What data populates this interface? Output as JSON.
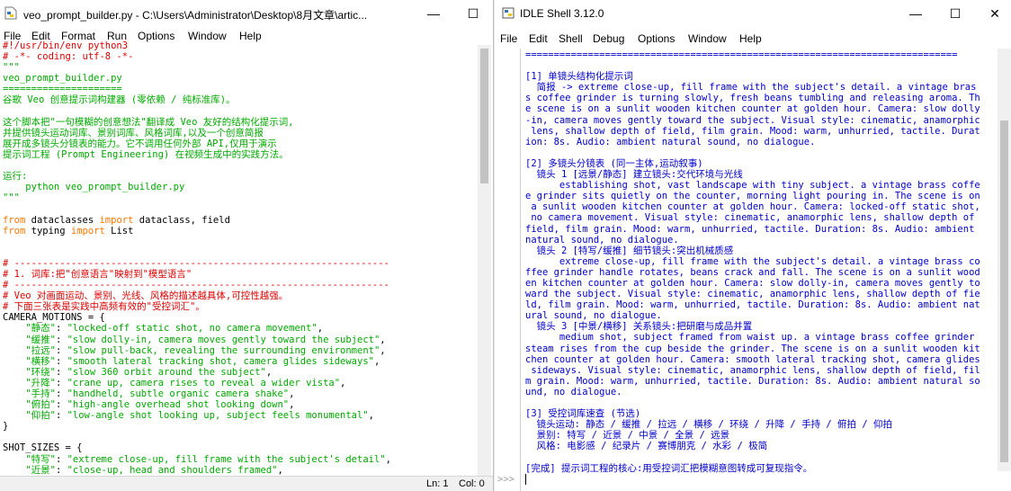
{
  "editor": {
    "title": "veo_prompt_builder.py - C:\\Users\\Administrator\\Desktop\\8月文章\\artic...",
    "menu": [
      "File",
      "Edit",
      "Format",
      "Run",
      "Options",
      "Window",
      "Help"
    ],
    "lines": [
      [
        [
          "c-com",
          "#!/usr/bin/env python3"
        ]
      ],
      [
        [
          "c-com",
          "# -*- coding: utf-8 -*-"
        ]
      ],
      [
        [
          "c-str",
          "\"\"\""
        ]
      ],
      [
        [
          "c-str",
          "veo_prompt_builder.py"
        ]
      ],
      [
        [
          "c-str",
          "====================="
        ]
      ],
      [
        [
          "c-str",
          "谷歌 Veo 创意提示词构建器 (零依赖 / 纯标准库)。"
        ]
      ],
      [
        [
          "c-str",
          ""
        ]
      ],
      [
        [
          "c-str",
          "这个脚本把\"一句模糊的创意想法\"翻译成 Veo 友好的结构化提示词,"
        ]
      ],
      [
        [
          "c-str",
          "并提供镜头运动词库、景别词库、风格词库,以及一个创意简报"
        ]
      ],
      [
        [
          "c-str",
          "展开成多镜头分镜表的能力。它不调用任何外部 API,仅用于演示"
        ]
      ],
      [
        [
          "c-str",
          "提示词工程 (Prompt Engineering) 在视频生成中的实践方法。"
        ]
      ],
      [
        [
          "c-str",
          ""
        ]
      ],
      [
        [
          "c-str",
          "运行:"
        ]
      ],
      [
        [
          "c-str",
          "    python veo_prompt_builder.py"
        ]
      ],
      [
        [
          "c-str",
          "\"\"\""
        ]
      ],
      [
        [
          "c-def",
          ""
        ]
      ],
      [
        [
          "c-kw",
          "from"
        ],
        [
          "c-def",
          " dataclasses "
        ],
        [
          "c-kw",
          "import"
        ],
        [
          "c-def",
          " dataclass, field"
        ]
      ],
      [
        [
          "c-kw",
          "from"
        ],
        [
          "c-def",
          " typing "
        ],
        [
          "c-kw",
          "import"
        ],
        [
          "c-def",
          " List"
        ]
      ],
      [
        [
          "c-def",
          ""
        ]
      ],
      [
        [
          "c-def",
          ""
        ]
      ],
      [
        [
          "c-com",
          "# ------------------------------------------------------------------"
        ]
      ],
      [
        [
          "c-com",
          "# 1. 词库:把\"创意语言\"映射到\"模型语言\""
        ]
      ],
      [
        [
          "c-com",
          "# ------------------------------------------------------------------"
        ]
      ],
      [
        [
          "c-com",
          "# Veo 对画面运动、景别、光线、风格的描述越具体,可控性越强。"
        ]
      ],
      [
        [
          "c-com",
          "# 下面三张表是实践中高频有效的\"受控词汇\"。"
        ]
      ],
      [
        [
          "c-def",
          "CAMERA_MOTIONS = {"
        ]
      ],
      [
        [
          "c-str",
          "    \"静态\""
        ],
        [
          "c-def",
          ": "
        ],
        [
          "c-str",
          "\"locked-off static shot, no camera movement\""
        ],
        [
          "c-def",
          ","
        ]
      ],
      [
        [
          "c-str",
          "    \"缓推\""
        ],
        [
          "c-def",
          ": "
        ],
        [
          "c-str",
          "\"slow dolly-in, camera moves gently toward the subject\""
        ],
        [
          "c-def",
          ","
        ]
      ],
      [
        [
          "c-str",
          "    \"拉远\""
        ],
        [
          "c-def",
          ": "
        ],
        [
          "c-str",
          "\"slow pull-back, revealing the surrounding environment\""
        ],
        [
          "c-def",
          ","
        ]
      ],
      [
        [
          "c-str",
          "    \"横移\""
        ],
        [
          "c-def",
          ": "
        ],
        [
          "c-str",
          "\"smooth lateral tracking shot, camera glides sideways\""
        ],
        [
          "c-def",
          ","
        ]
      ],
      [
        [
          "c-str",
          "    \"环绕\""
        ],
        [
          "c-def",
          ": "
        ],
        [
          "c-str",
          "\"slow 360 orbit around the subject\""
        ],
        [
          "c-def",
          ","
        ]
      ],
      [
        [
          "c-str",
          "    \"升降\""
        ],
        [
          "c-def",
          ": "
        ],
        [
          "c-str",
          "\"crane up, camera rises to reveal a wider vista\""
        ],
        [
          "c-def",
          ","
        ]
      ],
      [
        [
          "c-str",
          "    \"手持\""
        ],
        [
          "c-def",
          ": "
        ],
        [
          "c-str",
          "\"handheld, subtle organic camera shake\""
        ],
        [
          "c-def",
          ","
        ]
      ],
      [
        [
          "c-str",
          "    \"俯拍\""
        ],
        [
          "c-def",
          ": "
        ],
        [
          "c-str",
          "\"high-angle overhead shot looking down\""
        ],
        [
          "c-def",
          ","
        ]
      ],
      [
        [
          "c-str",
          "    \"仰拍\""
        ],
        [
          "c-def",
          ": "
        ],
        [
          "c-str",
          "\"low-angle shot looking up, subject feels monumental\""
        ],
        [
          "c-def",
          ","
        ]
      ],
      [
        [
          "c-def",
          "}"
        ]
      ],
      [
        [
          "c-def",
          ""
        ]
      ],
      [
        [
          "c-def",
          "SHOT_SIZES = {"
        ]
      ],
      [
        [
          "c-str",
          "    \"特写\""
        ],
        [
          "c-def",
          ": "
        ],
        [
          "c-str",
          "\"extreme close-up, fill frame with the subject's detail\""
        ],
        [
          "c-def",
          ","
        ]
      ],
      [
        [
          "c-str",
          "    \"近景\""
        ],
        [
          "c-def",
          ": "
        ],
        [
          "c-str",
          "\"close-up, head and shoulders framed\""
        ],
        [
          "c-def",
          ","
        ]
      ]
    ],
    "status": {
      "line": "Ln: 1",
      "col": "Col: 0"
    }
  },
  "shell": {
    "title": "IDLE Shell 3.12.0",
    "menu": [
      "File",
      "Edit",
      "Shell",
      "Debug",
      "Options",
      "Window",
      "Help"
    ],
    "lines": [
      "============================================================================",
      "",
      "[1] 单镜头结构化提示词",
      "  简报 -> extreme close-up, fill frame with the subject's detail. a vintage bras",
      "s coffee grinder is turning slowly, fresh beans tumbling and releasing aroma. Th",
      "e scene is on a sunlit wooden kitchen counter at golden hour. Camera: slow dolly",
      "-in, camera moves gently toward the subject. Visual style: cinematic, anamorphic",
      " lens, shallow depth of field, film grain. Mood: warm, unhurried, tactile. Durat",
      "ion: 8s. Audio: ambient natural sound, no dialogue.",
      "",
      "[2] 多镜头分镜表 (同一主体,运动叙事)",
      "  镜头 1 [远景/静态] 建立镜头:交代环境与光线",
      "      establishing shot, vast landscape with tiny subject. a vintage brass coffe",
      "e grinder sits quietly on the counter, morning light pouring in. The scene is on",
      " a sunlit wooden kitchen counter at golden hour. Camera: locked-off static shot,",
      " no camera movement. Visual style: cinematic, anamorphic lens, shallow depth of",
      "field, film grain. Mood: warm, unhurried, tactile. Duration: 8s. Audio: ambient",
      "natural sound, no dialogue.",
      "  镜头 2 [特写/缓推] 细节镜头:突出机械质感",
      "      extreme close-up, fill frame with the subject's detail. a vintage brass co",
      "ffee grinder handle rotates, beans crack and fall. The scene is on a sunlit wood",
      "en kitchen counter at golden hour. Camera: slow dolly-in, camera moves gently to",
      "ward the subject. Visual style: cinematic, anamorphic lens, shallow depth of fie",
      "ld, film grain. Mood: warm, unhurried, tactile. Duration: 8s. Audio: ambient nat",
      "ural sound, no dialogue.",
      "  镜头 3 [中景/横移] 关系镜头:把研磨与成品并置",
      "      medium shot, subject framed from waist up. a vintage brass coffee grinder",
      "steam rises from the cup beside the grinder. The scene is on a sunlit wooden kit",
      "chen counter at golden hour. Camera: smooth lateral tracking shot, camera glides",
      " sideways. Visual style: cinematic, anamorphic lens, shallow depth of field, fil",
      "m grain. Mood: warm, unhurried, tactile. Duration: 8s. Audio: ambient natural so",
      "und, no dialogue.",
      "",
      "[3] 受控词库速查 (节选)",
      "  镜头运动: 静态 / 缓推 / 拉远 / 横移 / 环绕 / 升降 / 手持 / 俯拍 / 仰拍",
      "  景别: 特写 / 近景 / 中景 / 全景 / 远景",
      "  风格: 电影感 / 纪录片 / 赛博朋克 / 水彩 / 极简",
      "",
      "[完成] 提示词工程的核心:用受控词汇把模糊意图转成可复现指令。"
    ],
    "prompt": ">>>"
  },
  "window_controls": {
    "minimize": "—",
    "maximize": "☐",
    "close": "✕"
  }
}
